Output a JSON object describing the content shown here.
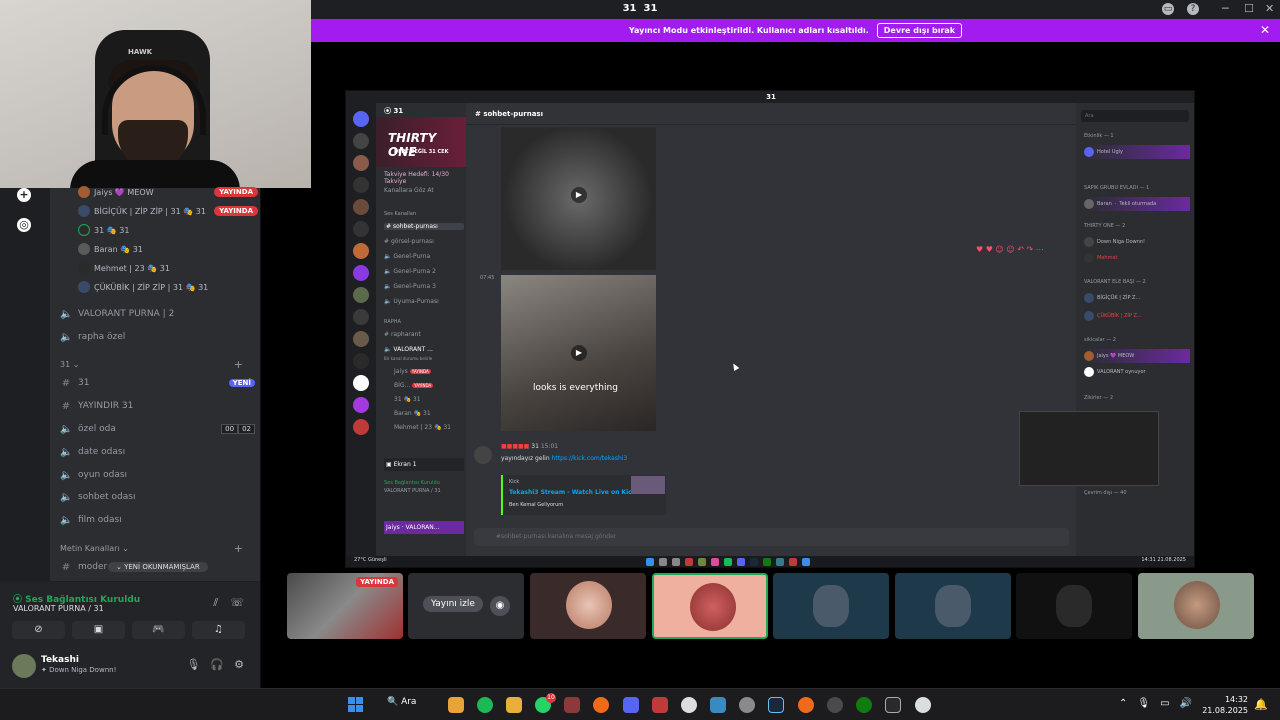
{
  "window": {
    "title": "31",
    "title_icon": "31"
  },
  "banner": {
    "text": "Yayıncı Modu etkinleştirildi. Kullanıcı adları kısaltıldı.",
    "button": "Devre dışı bırak"
  },
  "webcam": {
    "cap_text": "HAWK"
  },
  "sidebar": {
    "voice_users": [
      {
        "name": "Jaiys 💜 MEOW",
        "live": "YAYINDA"
      },
      {
        "name": "BİGİÇÜK | ZİP ZİP | 31 🎭 31",
        "live": "YAYINDA"
      },
      {
        "name": "31 🎭 31",
        "live": ""
      },
      {
        "name": "Baran 🎭 31",
        "live": ""
      },
      {
        "name": "Mehmet | 23 🎭 31",
        "live": ""
      },
      {
        "name": "ÇÜKÜBİK | ZİP ZİP | 31 🎭 31",
        "live": ""
      }
    ],
    "channels_a": [
      {
        "name": "VALORANT PURNA | 2",
        "icon": "speaker-icon"
      },
      {
        "name": "rapha özel",
        "icon": "speaker-icon"
      }
    ],
    "category_31": "31",
    "channels_b": [
      {
        "name": "31",
        "badge": "YENİ"
      },
      {
        "name": "YAYINDIR 31"
      }
    ],
    "voice_channels": [
      {
        "name": "özel oda",
        "count_a": "00",
        "count_b": "02"
      },
      {
        "name": "date odası"
      },
      {
        "name": "oyun odası"
      },
      {
        "name": "sohbet odası"
      },
      {
        "name": "film odası"
      }
    ],
    "category_metin": "Metin Kanalları",
    "moder_channel": "moder",
    "unread_pill": "YENİ OKUNMAMIŞLAR"
  },
  "voice_panel": {
    "status": "Ses Bağlantısı Kuruldu",
    "channel": "VALORANT PURNA / 31"
  },
  "user_panel": {
    "name": "Tekashi",
    "status": "Down Niga Downn!"
  },
  "stream": {
    "title": "31",
    "server_name": "31",
    "banner_title": "THIRTY ONE",
    "banner_subtitle": "DERT DEĞİL 31 CEK",
    "boost": "Takviye Hedefi: 14/30 Takviye",
    "browse": "Kanallara Göz At",
    "cat_voice": "Ses Kanalları",
    "text_channels": [
      {
        "name": "sohbet-purnası",
        "active": true
      },
      {
        "name": "görsel-purnası",
        "active": false
      },
      {
        "name": "Genel-Purna",
        "active": false
      },
      {
        "name": "Genel-Purna 2",
        "active": false
      },
      {
        "name": "Genel-Purna 3",
        "active": false
      },
      {
        "name": "Uyuma-Purnası",
        "active": false
      }
    ],
    "cat_rapha": "RAPHA",
    "rapharant": "rapharant",
    "valorant": "VALORANT ...",
    "valorant_sub": "Bir kanal durumu belirle",
    "stream_users": [
      {
        "name": "Jaiys",
        "live": "YAYINDA"
      },
      {
        "name": "BİG...",
        "live": "YAYINDA"
      },
      {
        "name": "31 🎭 31",
        "live": ""
      },
      {
        "name": "Baran 🎭 31",
        "live": ""
      },
      {
        "name": "Mehmet | 23 🎭 31",
        "live": ""
      }
    ],
    "screen_label": "Ekran 1",
    "s_voice_status": "Ses Bağlantısı Kuruldu",
    "s_voice_channel": "VALORANT PURNA / 31",
    "s_user": "Jaiys",
    "s_user_status": "VALORAN...",
    "channel_header": "sohbet-purnası",
    "video_caption": "looks is everything",
    "msg_time": "07:45",
    "msg_author": "31",
    "msg_time2": "15:01",
    "msg_text": "yayındayız gelin",
    "msg_link": "https://kick.com/tekashi3",
    "embed_site": "Kick",
    "embed_title": "Tekashi3 Stream - Watch Live on Kick",
    "embed_desc": "Ben Kemal Geliyorum",
    "input_placeholder": "#sohbet-purnası kanalına mesaj gönder",
    "search_placeholder": "Ara",
    "members": {
      "cat_online": "Etkinlik — 1",
      "hotel": "Hotel Ugly",
      "cat_sapik": "SAPIK GRUBU EVLADI — 1",
      "baran": "Baran",
      "baran_status": "Tekli oturmada",
      "cat_thirty": "THIRTY ONE — 2",
      "down": "Down Niga Downn!",
      "mehmet": "Mehmet",
      "cat_valorant": "VALORANT ELE BAŞI — 2",
      "bigicuk": "BİGİÇÜK | ZİP Z...",
      "bigicuk_status": "Modu yayınlıyor",
      "cukubik": "ÇÜKÜBİK | ZİP Z...",
      "cat_siik": "sikicalar — 2",
      "jaiys": "Jaiys 💜 MEOW",
      "jaiys_status": "VALORANT oynuyor",
      "cat_zikirler": "Zikirler — 2",
      "cat_cevrim": "Çevrim dışı — 40"
    },
    "taskbar_temp": "27°C",
    "taskbar_weather": "Güneşli",
    "taskbar_time": "14:31",
    "taskbar_date": "21.08.2025"
  },
  "tiles": {
    "live": "YAYINDA",
    "watch": "Yayını izle"
  },
  "taskbar": {
    "search": "Ara",
    "badge": "10",
    "time": "14:32",
    "date": "21.08.2025"
  }
}
